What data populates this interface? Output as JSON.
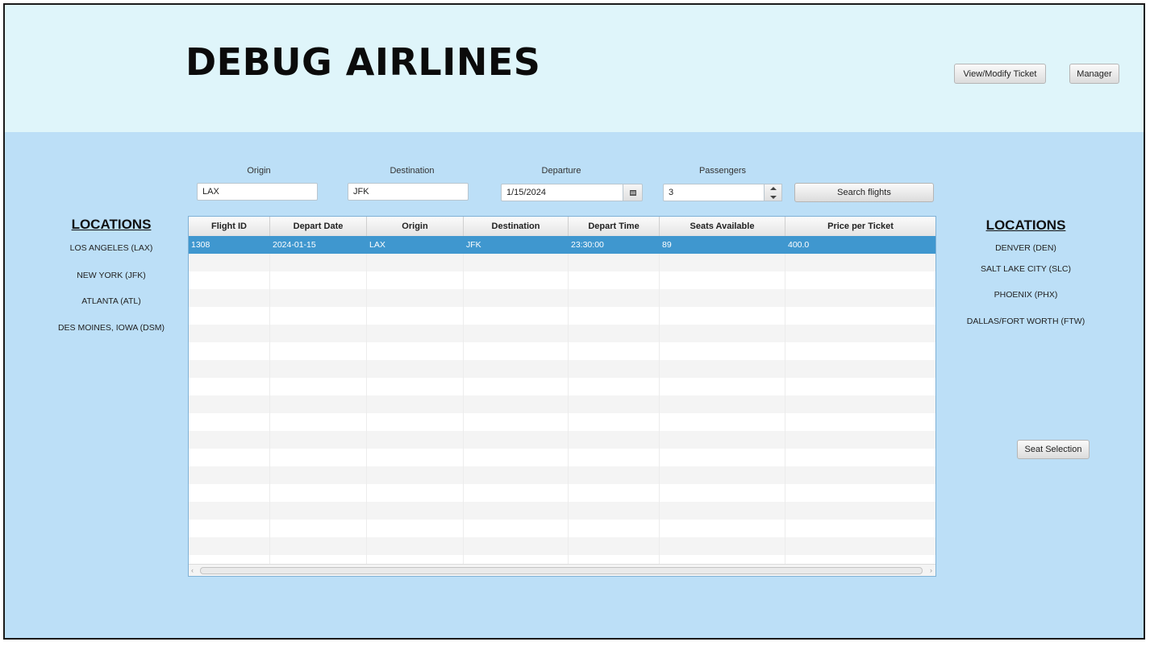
{
  "header": {
    "title": "DEBUG AIRLINES",
    "view_modify_label": "View/Modify Ticket",
    "manager_label": "Manager"
  },
  "search": {
    "origin_label": "Origin",
    "origin_value": "LAX",
    "destination_label": "Destination",
    "destination_value": "JFK",
    "departure_label": "Departure",
    "departure_value": "1/15/2024",
    "passengers_label": "Passengers",
    "passengers_value": "3",
    "search_button": "Search flights"
  },
  "left_locations": {
    "heading": "LOCATIONS",
    "items": [
      "LOS ANGELES (LAX)",
      "NEW YORK (JFK)",
      "ATLANTA (ATL)",
      "DES MOINES, IOWA (DSM)"
    ]
  },
  "right_locations": {
    "heading": "LOCATIONS",
    "items": [
      "DENVER (DEN)",
      "SALT LAKE CITY (SLC)",
      "PHOENIX (PHX)",
      "DALLAS/FORT WORTH (FTW)"
    ]
  },
  "table": {
    "columns": [
      "Flight ID",
      "Depart Date",
      "Origin",
      "Destination",
      "Depart Time",
      "Seats Available",
      "Price per Ticket"
    ],
    "rows": [
      [
        "1308",
        "2024-01-15",
        "LAX",
        "JFK",
        "23:30:00",
        "89",
        "400.0"
      ]
    ]
  },
  "seat_selection_label": "Seat Selection",
  "colors": {
    "header_bg": "#dff5fa",
    "main_bg": "#bcdff7",
    "selected_row": "#3f97cf"
  }
}
